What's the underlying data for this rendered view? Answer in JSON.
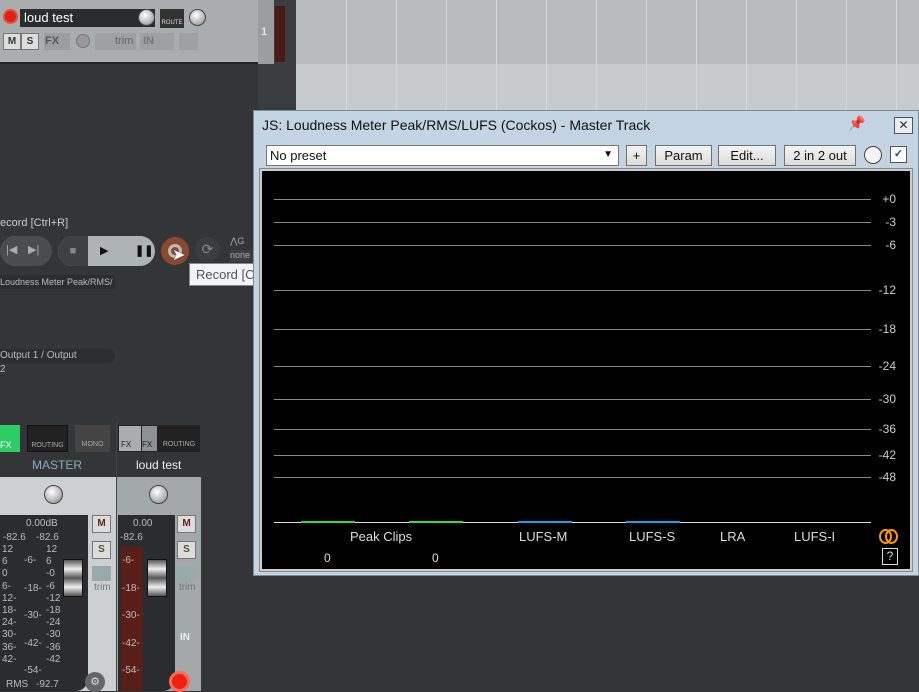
{
  "track": {
    "name": "loud test",
    "number": "1",
    "route_label": "ROUTE",
    "mute": "M",
    "solo": "S",
    "fx": "FX",
    "trim": "trim",
    "input": "IN"
  },
  "transport": {
    "status": "ecord [Ctrl+R]",
    "tooltip": "Record [Ctrl+R]",
    "fx_name": "Loudness Meter Peak/RMS/",
    "io": "Output 1 / Output 2",
    "grid_label": "G",
    "grid_value": "none"
  },
  "mixer": {
    "master": {
      "name": "MASTER",
      "volume": "0.00dB",
      "peak_l": "-82.6",
      "peak_r": "-82.6",
      "fx": "FX",
      "routing": "ROUTING",
      "mono": "MONO",
      "mute": "M",
      "solo": "S",
      "trim": "trim",
      "rms_label": "RMS",
      "rms_value": "-92.7",
      "scale_left": [
        "12",
        "6",
        "0",
        "6-",
        "12-",
        "18-",
        "24-",
        "30-",
        "36-",
        "42-"
      ],
      "scale_mid": [
        "-6-",
        "-18-",
        "-30-",
        "-42-",
        "-54-"
      ],
      "scale_right": [
        "12",
        "6",
        "-0",
        "-6",
        "-12",
        "-18",
        "-24",
        "-30",
        "-36",
        "-42"
      ]
    },
    "track": {
      "name": "loud test",
      "volume": "0.00",
      "peak": "-82.6",
      "fx": "FX",
      "in_fx": "FX",
      "routing": "ROUTING",
      "mute": "M",
      "solo": "S",
      "trim": "trim",
      "input": "IN",
      "scale": [
        "-6-",
        "-18-",
        "-30-",
        "-42-",
        "-54-"
      ]
    }
  },
  "plugin": {
    "title": "JS: Loudness Meter Peak/RMS/LUFS (Cockos) - Master Track",
    "preset": "No preset",
    "plus": "+",
    "param": "Param",
    "edit": "Edit...",
    "io": "2 in 2 out",
    "enabled": true,
    "scale": [
      "+0",
      "-3",
      "-6",
      "-12",
      "-18",
      "-24",
      "-30",
      "-36",
      "-42",
      "-48"
    ],
    "labels": [
      "Peak Clips",
      "LUFS-M",
      "LUFS-S",
      "LRA",
      "LUFS-I"
    ],
    "clips": [
      "0",
      "0"
    ],
    "help": "?",
    "colors": {
      "peak": "#33e033",
      "lufs": "#1aa0f0",
      "stereo": "#ff9900"
    }
  }
}
